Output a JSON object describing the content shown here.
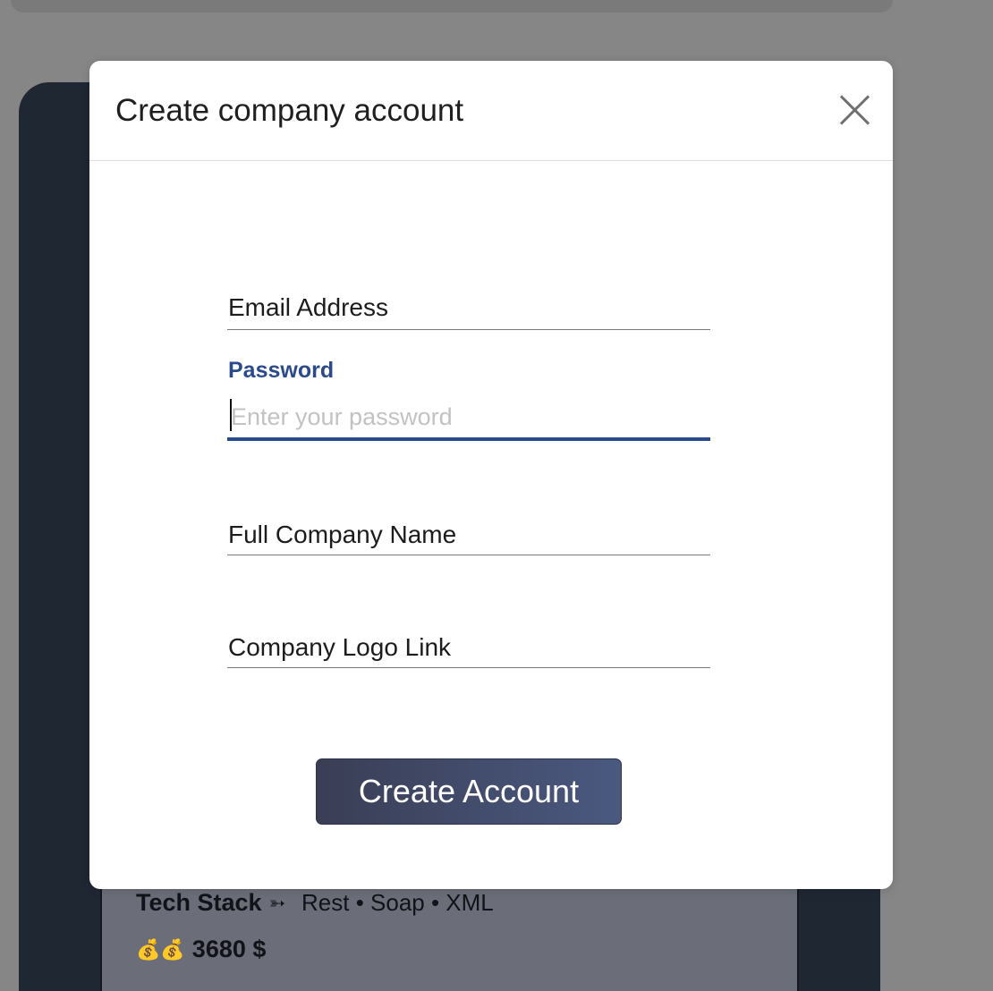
{
  "background": {
    "tech_stack_label": "Tech Stack",
    "tech_stack_arrow": "➳",
    "tech_stack_values": "Rest • Soap • XML",
    "money_icons": "💰💰",
    "price": "3680 $",
    "partial_row": "…  …   ……  ……"
  },
  "modal": {
    "title": "Create company account",
    "fields": {
      "email": {
        "label": "Email Address"
      },
      "password": {
        "label": "Password",
        "placeholder": "Enter your password",
        "value": ""
      },
      "company_name": {
        "label": "Full Company Name"
      },
      "logo_link": {
        "label": "Company Logo Link"
      }
    },
    "submit_label": "Create Account"
  },
  "colors": {
    "accent": "#2b4a8c",
    "overlay": "#868686",
    "button_gradient_start": "#3a3e55",
    "button_gradient_end": "#4a5980"
  },
  "icons": {
    "close": "close-icon"
  }
}
